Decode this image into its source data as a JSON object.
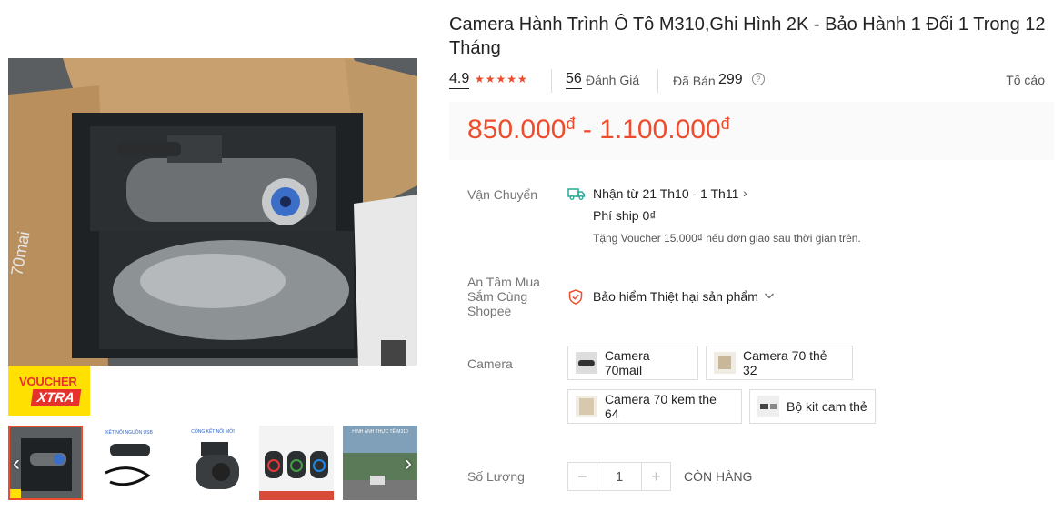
{
  "product": {
    "title": "Camera Hành Trình Ô Tô M310,Ghi Hình 2K - Bảo Hành 1 Đổi 1 Trong 12 Tháng"
  },
  "rating": {
    "score": "4.9",
    "stars": 5,
    "review_count": "56",
    "review_label": "Đánh Giá",
    "sold_label": "Đã Bán",
    "sold_count": "299",
    "report_label": "Tố cáo"
  },
  "price": {
    "low": "850.000",
    "high": "1.100.000",
    "currency": "đ",
    "separator": "-"
  },
  "shipping": {
    "label": "Vận Chuyển",
    "delivery": "Nhận từ 21 Th10 - 1 Th11",
    "fee": "Phí ship 0₫",
    "note": "Tặng Voucher 15.000₫ nếu đơn giao sau thời gian trên."
  },
  "insurance": {
    "label_line1": "An Tâm Mua",
    "label_line2": "Sắm Cùng",
    "label_line3": "Shopee",
    "value": "Bảo hiểm Thiệt hại sản phẩm"
  },
  "variants": {
    "label": "Camera",
    "options": [
      {
        "name": "Camera 70mail"
      },
      {
        "name": "Camera 70 thẻ 32"
      },
      {
        "name": "Camera 70 kem the 64"
      },
      {
        "name": "Bộ kit cam thẻ"
      }
    ]
  },
  "quantity": {
    "label": "Số Lượng",
    "value": "1",
    "minus": "−",
    "plus": "+",
    "stock_status": "CÒN HÀNG"
  },
  "badge": {
    "line1": "VOUCHER",
    "line2": "XTRA"
  },
  "gallery": {
    "thumb_labels": [
      "KẾT NỐI NGUỒN USB",
      "CỔNG KẾT NỐI MỚI",
      "HÌNH ẢNH THỰC TẾ M310"
    ],
    "prev": "‹",
    "next": "›"
  },
  "photo_text": {
    "brand": "70mai"
  },
  "colors": {
    "accent": "#ee4d2d",
    "star": "#ee4d2d",
    "voucher_bg": "#ffe000"
  }
}
